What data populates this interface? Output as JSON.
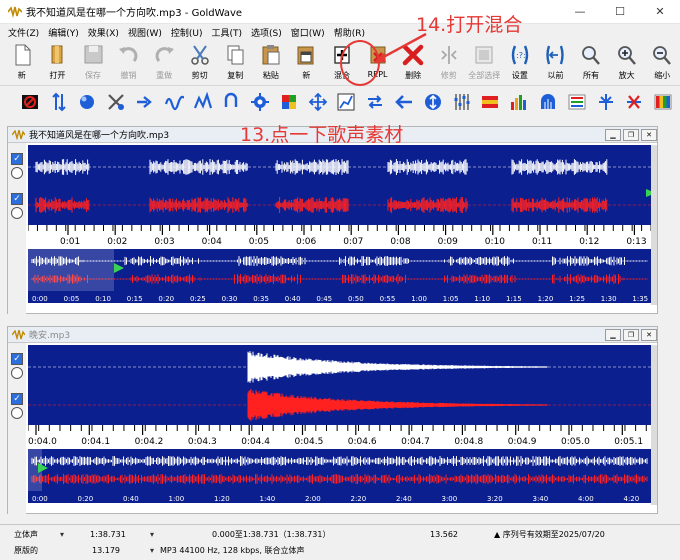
{
  "window": {
    "title": "我不知道风是在哪一个方向吹.mp3 - GoldWave",
    "minimize": "—",
    "maximize": "☐",
    "close": "✕"
  },
  "menu": [
    "文件(Z)",
    "编辑(Y)",
    "效果(X)",
    "视图(W)",
    "控制(U)",
    "工具(T)",
    "选项(S)",
    "窗口(W)",
    "帮助(R)"
  ],
  "toolbar": [
    {
      "id": "new",
      "label": "新",
      "icon": "new-file-icon",
      "disabled": false
    },
    {
      "id": "open",
      "label": "打开",
      "icon": "folder-icon",
      "disabled": false
    },
    {
      "id": "save",
      "label": "保存",
      "icon": "floppy-icon",
      "disabled": true
    },
    {
      "id": "undo",
      "label": "撤销",
      "icon": "undo-icon",
      "disabled": true
    },
    {
      "id": "redo",
      "label": "重做",
      "icon": "redo-icon",
      "disabled": true
    },
    {
      "id": "cut",
      "label": "剪切",
      "icon": "scissors-icon",
      "disabled": false
    },
    {
      "id": "copy",
      "label": "复制",
      "icon": "copy-icon",
      "disabled": false
    },
    {
      "id": "paste",
      "label": "粘贴",
      "icon": "paste-icon",
      "disabled": false
    },
    {
      "id": "pastenew",
      "label": "新",
      "icon": "paste-new-icon",
      "disabled": false
    },
    {
      "id": "mix",
      "label": "混合",
      "icon": "mix-icon",
      "disabled": false
    },
    {
      "id": "repl",
      "label": "REPL",
      "icon": "replace-icon",
      "disabled": false
    },
    {
      "id": "delete",
      "label": "删除",
      "icon": "delete-icon",
      "disabled": false
    },
    {
      "id": "trim",
      "label": "修剪",
      "icon": "trim-icon",
      "disabled": true
    },
    {
      "id": "selall",
      "label": "全部选择",
      "icon": "select-all-icon",
      "disabled": true
    },
    {
      "id": "set",
      "label": "设置",
      "icon": "set-marker-icon",
      "disabled": false
    },
    {
      "id": "prev",
      "label": "以前",
      "icon": "previous-icon",
      "disabled": false
    },
    {
      "id": "all",
      "label": "所有",
      "icon": "zoom-all-icon",
      "disabled": false
    },
    {
      "id": "zoomin",
      "label": "放大",
      "icon": "zoom-in-icon",
      "disabled": false
    },
    {
      "id": "zoomout",
      "label": "缩小",
      "icon": "zoom-out-icon",
      "disabled": false
    }
  ],
  "effects_icons": [
    "stop-sign-icon",
    "vertical-arrows-icon",
    "blue-sphere-icon",
    "cross-tools-icon",
    "arrow-right-blue-icon",
    "wave-blue-icon",
    "wave-peak-icon",
    "loop-icon",
    "gear-blue-icon",
    "color-square-icon",
    "expand-arrows-icon",
    "graph-icon",
    "bi-arrow-icon",
    "left-arrow-icon",
    "up-down-circle-icon",
    "equalizer-icon",
    "spectrum-icon",
    "rainbow-bars-icon",
    "arch-icon",
    "color-bars-icon",
    "split-icon",
    "crossed-arrows-icon",
    "color-spectrum-icon"
  ],
  "annotations": {
    "step14": "14.打开混合",
    "step13": "13.点一下歌声素材"
  },
  "doc1": {
    "title": "我不知道风是在哪一个方向吹.mp3",
    "ch_scale": [
      "1",
      "0",
      "1",
      "0"
    ],
    "ruler": [
      "0:01",
      "0:02",
      "0:03",
      "0:04",
      "0:05",
      "0:06",
      "0:07",
      "0:08",
      "0:09",
      "0:10",
      "0:11",
      "0:12",
      "0:13"
    ],
    "overview_ruler": [
      "0:00",
      "0:05",
      "0:10",
      "0:15",
      "0:20",
      "0:25",
      "0:30",
      "0:35",
      "0:40",
      "0:45",
      "0:50",
      "0:55",
      "1:00",
      "1:05",
      "1:10",
      "1:15",
      "1:20",
      "1:25",
      "1:30",
      "1:35"
    ]
  },
  "doc2": {
    "title": "晚安.mp3",
    "ch_scale": [
      "1",
      "0",
      "1",
      "0"
    ],
    "ruler": [
      "0:04.0",
      "0:04.1",
      "0:04.2",
      "0:04.3",
      "0:04.4",
      "0:04.5",
      "0:04.6",
      "0:04.7",
      "0:04.8",
      "0:04.9",
      "0:05.0",
      "0:05.1"
    ],
    "overview_ruler": [
      "0:00",
      "0:20",
      "0:40",
      "1:00",
      "1:20",
      "1:40",
      "2:00",
      "2:20",
      "2:40",
      "3:00",
      "3:20",
      "3:40",
      "4:00",
      "4:20"
    ]
  },
  "status": {
    "row1": {
      "channel": "立体声",
      "duration": "1:38.731",
      "selection": "0.000至1:38.731（1:38.731）",
      "position": "13.562",
      "notice": "序列号有效期至2025/07/20"
    },
    "row2": {
      "channel": "原版的",
      "value": "13.179",
      "format": "MP3 44100 Hz, 128 kbps, 联合立体声"
    }
  },
  "colors": {
    "wave_bg": "#0b1f8f",
    "left_channel": "#ffffff",
    "right_channel": "#ff2020",
    "annotation": "#e53935",
    "play_marker": "#39d353"
  }
}
